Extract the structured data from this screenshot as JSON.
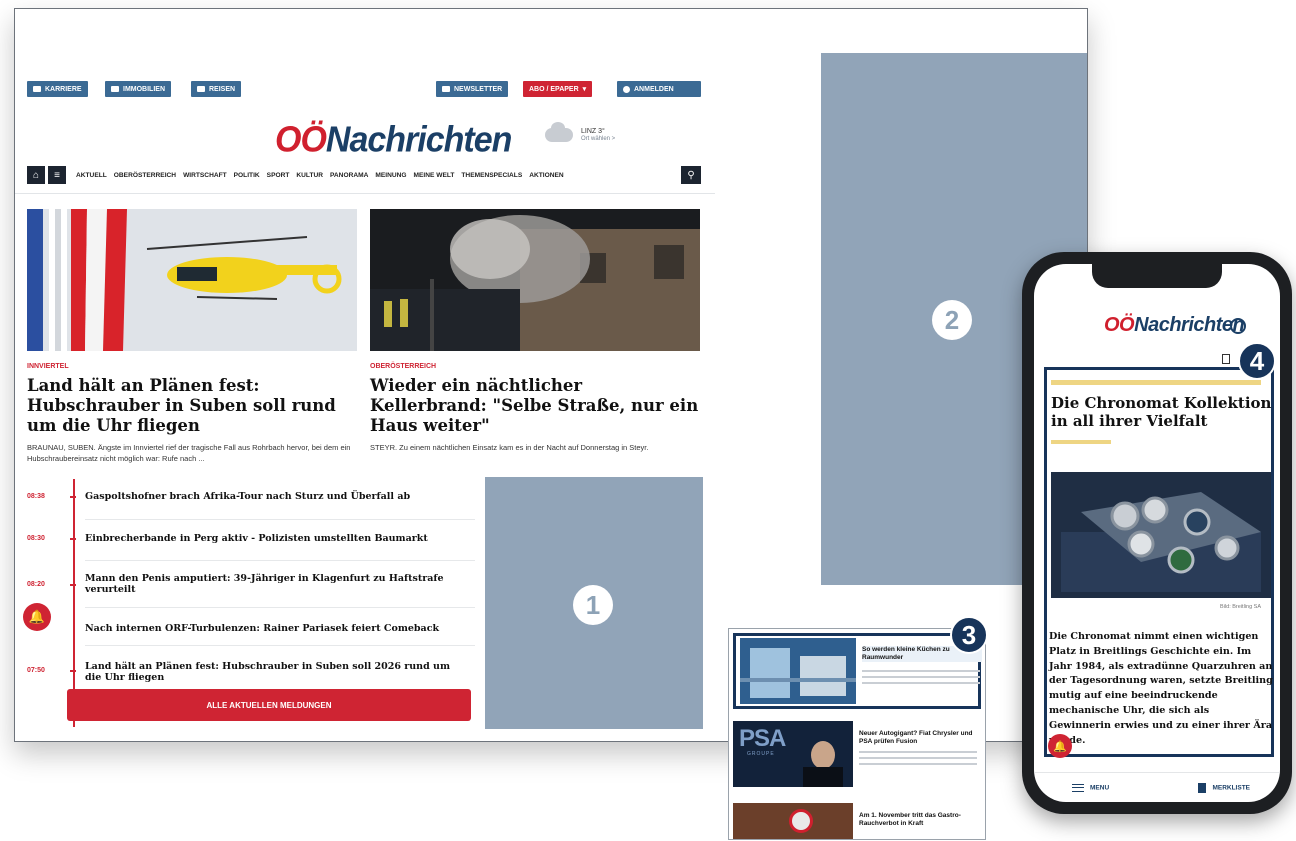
{
  "desktop": {
    "topbar": {
      "karriere": "KARRIERE",
      "immobilien": "IMMOBILIEN",
      "reisen": "REISEN",
      "newsletter": "NEWSLETTER",
      "abo": "ABO / EPAPER",
      "anmelden": "ANMELDEN"
    },
    "logo": {
      "oo": "OÖ",
      "rest": "Nachrichten"
    },
    "weather": {
      "city": "LINZ 3°",
      "change": "Ort wählen >"
    },
    "nav": [
      "AKTUELL",
      "OBERÖSTERREICH",
      "WIRTSCHAFT",
      "POLITIK",
      "SPORT",
      "KULTUR",
      "PANORAMA",
      "MEINUNG",
      "MEINE WELT",
      "THEMENSPECIALS",
      "AKTIONEN"
    ],
    "teasers": [
      {
        "kicker": "INNVIERTEL",
        "headline": "Land hält an Plänen fest: Hubschrauber in Suben soll rund um die Uhr fliegen",
        "lead": "BRAUNAU, SUBEN. Ängste im Innviertel rief der tragische Fall aus Rohrbach hervor, bei dem ein Hubschraubereinsatz nicht möglich war: Rufe nach ..."
      },
      {
        "kicker": "OBERÖSTERREICH",
        "headline": "Wieder ein nächtlicher Kellerbrand: \"Selbe Straße, nur ein Haus weiter\"",
        "lead": "STEYR. Zu einem nächtlichen Einsatz kam es in der Nacht auf Donnerstag in Steyr."
      }
    ],
    "ticker": [
      {
        "time": "08:38",
        "text": "Gaspoltshofner brach Afrika-Tour nach Sturz und Überfall ab"
      },
      {
        "time": "08:30",
        "text": "Einbrecherbande in Perg aktiv - Polizisten umstellten Baumarkt"
      },
      {
        "time": "08:20",
        "text": "Mann den Penis amputiert: 39-Jähriger in Klagenfurt zu Haftstrafe verurteilt"
      },
      {
        "time": "",
        "text": "Nach internen ORF-Turbulenzen: Rainer Pariasek feiert Comeback"
      },
      {
        "time": "07:50",
        "text": "Land hält an Plänen fest: Hubschrauber in Suben soll 2026 rund um die Uhr fliegen"
      }
    ],
    "all_button": "ALLE AKTUELLEN MELDUNGEN"
  },
  "badges": {
    "one": "1",
    "two": "2",
    "three": "3",
    "four": "4"
  },
  "cards": [
    {
      "kicker": "",
      "headline": "So werden kleine Küchen zu Raumwunder"
    },
    {
      "kicker": "",
      "headline": "Neuer Autogigant? Fiat Chrysler und PSA prüfen Fusion"
    },
    {
      "kicker": "",
      "headline": "Am 1. November tritt das Gastro-Rauchverbot in Kraft"
    }
  ],
  "card_logo": {
    "psa": "PSA",
    "groupe": "GROUPE"
  },
  "phone": {
    "logo": {
      "oo": "OÖ",
      "rest": "Nachrichten"
    },
    "title": "Die Chronomat Kollektion in all ihrer Vielfalt",
    "credit": "Bild: Breitling SA",
    "text": "Die Chronomat nimmt einen wichtigen Platz in Breitlings Geschichte ein. Im Jahr 1984, als extradünne Quarzuhren an der Tagesordnung waren, setzte Breitling mutig auf eine beeindruckende mechanische Uhr, die sich als Gewinnerin erwies und zu einer ihrer Ära wurde.",
    "menu": "MENU",
    "merkliste": "MERKLISTE"
  }
}
